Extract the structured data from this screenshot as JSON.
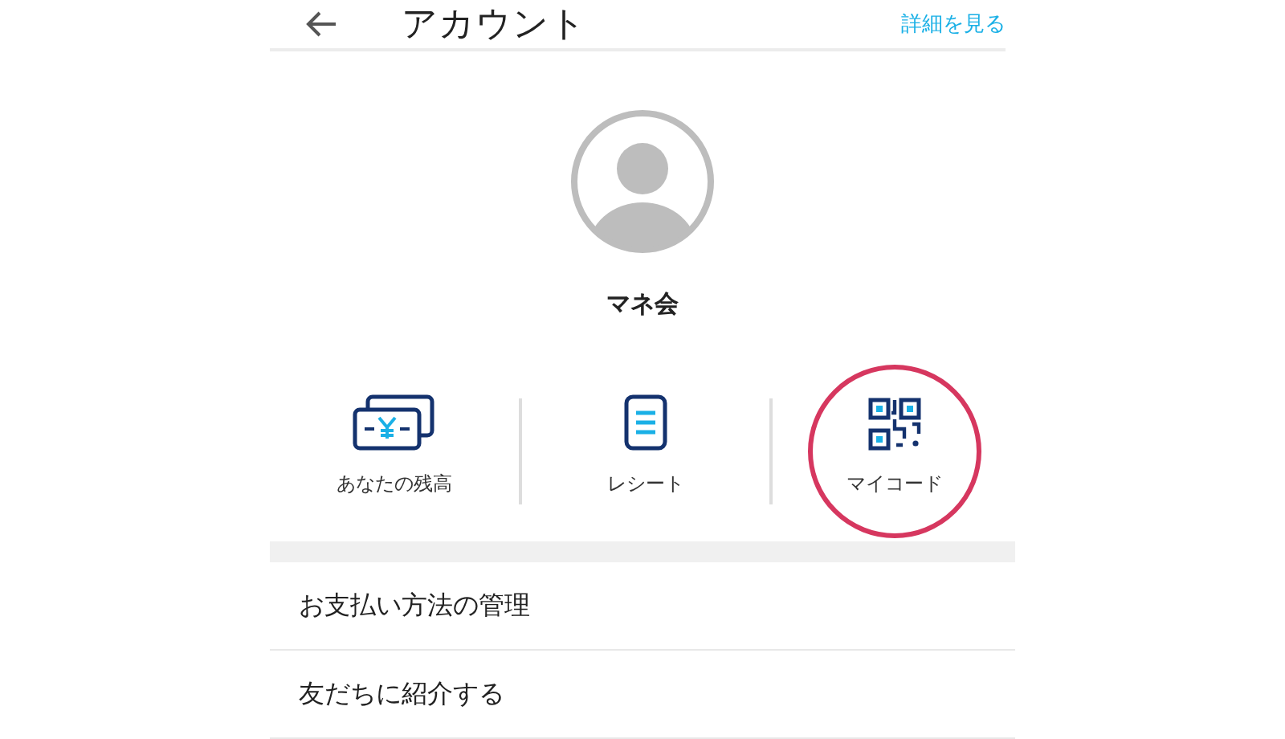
{
  "header": {
    "title": "アカウント",
    "link": "詳細を見る"
  },
  "profile": {
    "name": "マネ会"
  },
  "actions": [
    {
      "kind": "balance",
      "label": "あなたの残高",
      "highlighted": false
    },
    {
      "kind": "receipt",
      "label": "レシート",
      "highlighted": false
    },
    {
      "kind": "code",
      "label": "マイコード",
      "highlighted": true
    }
  ],
  "menu": [
    {
      "label": "お支払い方法の管理"
    },
    {
      "label": "友だちに紹介する"
    }
  ]
}
